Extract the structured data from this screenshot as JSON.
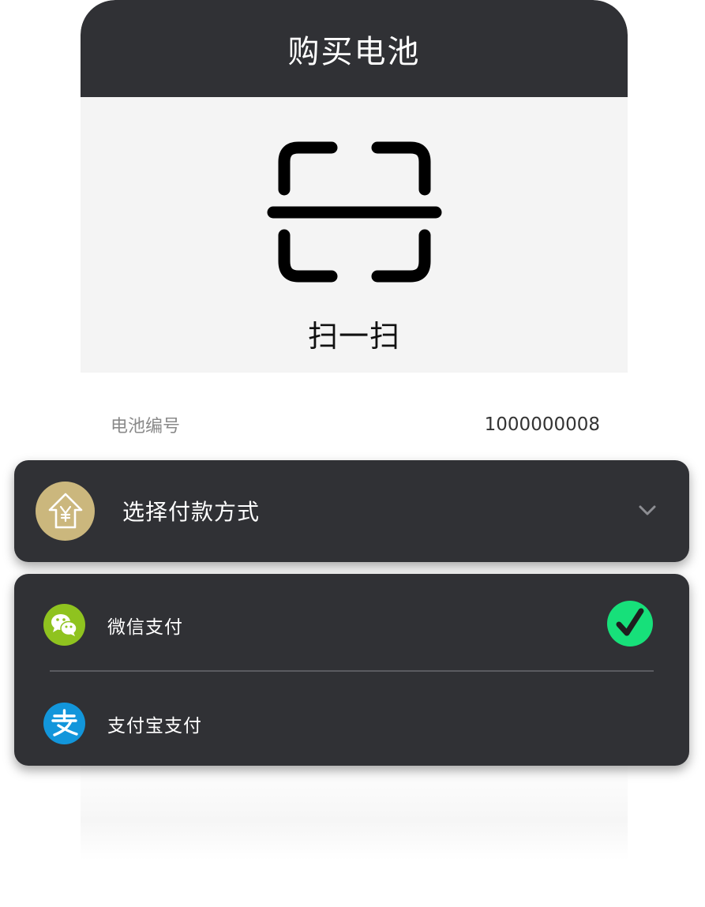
{
  "header": {
    "title": "购买电池"
  },
  "scan": {
    "label": "扫一扫",
    "icon": "scan-icon"
  },
  "battery": {
    "label": "电池编号",
    "value": "1000000008"
  },
  "payment_select": {
    "title": "选择付款方式",
    "logo_icon": "home-yen-icon",
    "expand_icon": "chevron-down-icon"
  },
  "payment_options": [
    {
      "label": "微信支付",
      "icon": "wechat-icon",
      "selected": true,
      "color": "#8fc31f"
    },
    {
      "label": "支付宝支付",
      "icon": "alipay-icon",
      "selected": false,
      "color": "#1296db"
    }
  ],
  "colors": {
    "dark_panel": "#303135",
    "check_green": "#17e07a",
    "logo_gold": "#cbb77d"
  }
}
